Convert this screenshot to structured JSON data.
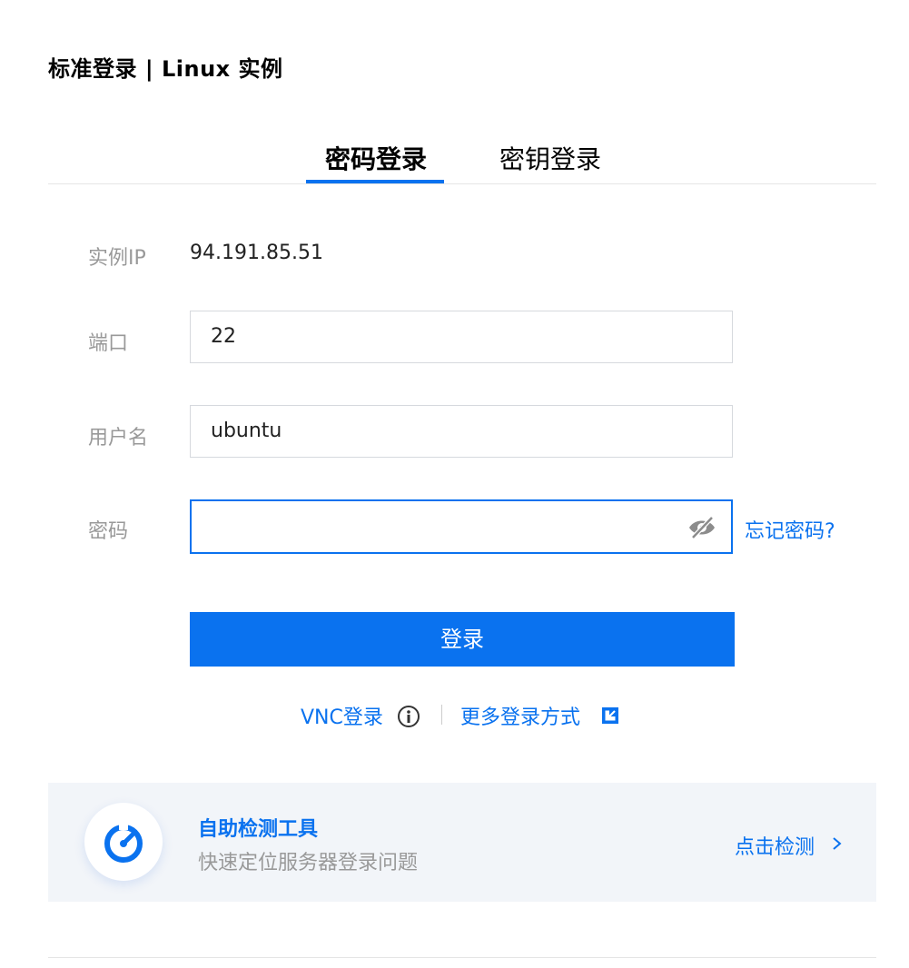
{
  "header": {
    "title": "标准登录 | Linux 实例"
  },
  "tabs": [
    {
      "label": "密码登录",
      "active": true
    },
    {
      "label": "密钥登录",
      "active": false
    }
  ],
  "form": {
    "ip_label": "实例IP",
    "ip_value": "94.191.85.51",
    "port_label": "端口",
    "port_value": "22",
    "user_label": "用户名",
    "user_value": "ubuntu",
    "password_label": "密码",
    "password_value": "",
    "password_icon": "eye-off-icon",
    "forgot_label": "忘记密码?"
  },
  "actions": {
    "login_label": "登录",
    "vnc_label": "VNC登录",
    "vnc_icon": "info-icon",
    "more_label": "更多登录方式",
    "more_icon": "external-link-icon"
  },
  "tool": {
    "title": "自助检测工具",
    "subtitle": "快速定位服务器登录问题",
    "link_label": "点击检测",
    "icon": "speedometer-icon",
    "link_icon": "chevron-right-icon"
  },
  "colors": {
    "accent": "#0a72ef",
    "muted_text": "#999999",
    "card_bg": "#f2f5f9"
  }
}
